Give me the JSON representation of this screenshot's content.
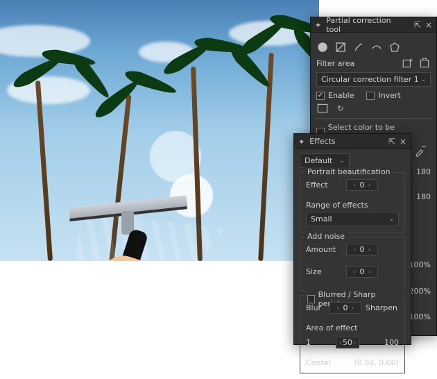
{
  "partial": {
    "title": "Partial correction tool",
    "filter_area_label": "Filter area",
    "filter_dropdown": "Circular correction filter 1",
    "enable": {
      "label": "Enable",
      "checked": true
    },
    "invert": {
      "label": "Invert",
      "checked": false
    },
    "select_color": {
      "label": "Select color to be corrected",
      "checked": false
    },
    "color_swatch": "#fb7a7a",
    "side_values": [
      "180",
      "180",
      "100%",
      "200%",
      "100%"
    ]
  },
  "effects": {
    "title": "Effects",
    "preset": "Default",
    "portrait": {
      "legend": "Portrait beautification",
      "effect_label": "Effect",
      "effect_value": "0",
      "range_label": "Range of effects",
      "range_value": "Small"
    },
    "noise": {
      "legend": "Add noise",
      "amount_label": "Amount",
      "amount_value": "0",
      "size_label": "Size",
      "size_value": "0"
    },
    "periphery": {
      "legend": "Blurred / Sharp periphery",
      "checked": false,
      "blur_label": "Blur",
      "sharpen_label": "Sharpen",
      "value": "0",
      "area_label": "Area of effect",
      "area_min": "1",
      "area_val": "50",
      "area_max": "100",
      "center_label": "Center",
      "center_value": "(0.00, 0.00)"
    }
  },
  "icons": {
    "pin": "⇱",
    "close": "×",
    "chev": "⌄",
    "reload": "↻"
  }
}
